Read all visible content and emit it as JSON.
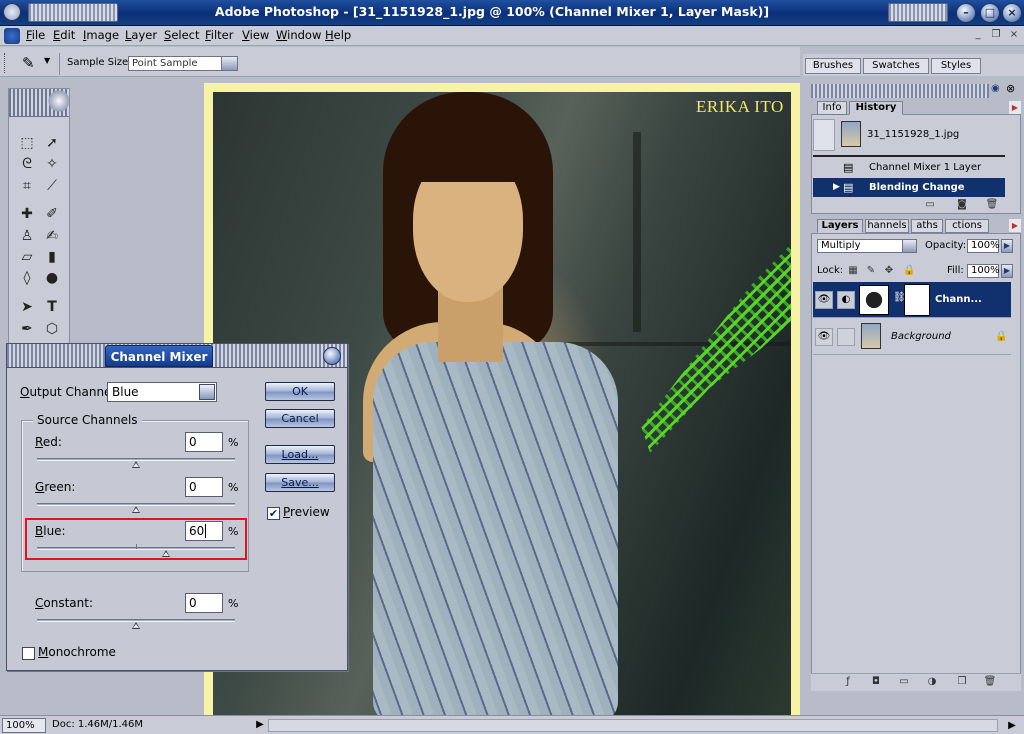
{
  "window": {
    "title": "Adobe Photoshop - [31_1151928_1.jpg @ 100% (Channel Mixer 1, Layer Mask)]",
    "controls": [
      "minimize",
      "maximize",
      "close"
    ]
  },
  "menubar": {
    "items": [
      "File",
      "Edit",
      "Image",
      "Layer",
      "Select",
      "Filter",
      "View",
      "Window",
      "Help"
    ]
  },
  "options_bar": {
    "sample_size_label": "Sample Size:",
    "sample_size_value": "Point Sample"
  },
  "palette_well": {
    "tabs": [
      "Brushes",
      "Swatches",
      "Styles"
    ]
  },
  "canvas": {
    "watermark": "ERIKA ITO"
  },
  "channel_mixer": {
    "title": "Channel Mixer",
    "output_channel_label": "Output Channel:",
    "output_channel_value": "Blue",
    "source_channels_label": "Source Channels",
    "red_label": "Red:",
    "red_value": "0",
    "green_label": "Green:",
    "green_value": "0",
    "blue_label": "Blue:",
    "blue_value": "60",
    "constant_label": "Constant:",
    "constant_value": "0",
    "percent": "%",
    "monochrome_label": "Monochrome",
    "monochrome_checked": false,
    "preview_label": "Preview",
    "preview_checked": true,
    "buttons": {
      "ok": "OK",
      "cancel": "Cancel",
      "load": "Load...",
      "save": "Save..."
    },
    "slider_levels_percent": {
      "red": 0,
      "green": 0,
      "blue": 60,
      "constant": 0
    }
  },
  "history_palette": {
    "tabs": [
      "Info",
      "History"
    ],
    "snapshot": "31_1151928_1.jpg",
    "steps": [
      "Channel Mixer 1 Layer",
      "Blending Change"
    ],
    "selected_step": "Blending Change"
  },
  "layers_palette": {
    "tabs": [
      "Layers",
      "Channels",
      "Paths",
      "Actions"
    ],
    "tab_visible_text": [
      "Layers",
      "hannels",
      "aths",
      "ctions"
    ],
    "blend_mode": "Multiply",
    "opacity_label": "Opacity:",
    "opacity_value": "100%",
    "lock_label": "Lock:",
    "fill_label": "Fill:",
    "fill_value": "100%",
    "layers": [
      {
        "name": "Chann...",
        "selected": true
      },
      {
        "name": "Background",
        "selected": false
      }
    ]
  },
  "statusbar": {
    "zoom": "100%",
    "doc": "Doc: 1.46M/1.46M"
  },
  "colors": {
    "titlebar": "#0b2f7a",
    "selection": "#10306e",
    "highlight_box": "#e0141a",
    "canvas_border": "#f6f4a4",
    "watermark": "#f1e86a"
  }
}
